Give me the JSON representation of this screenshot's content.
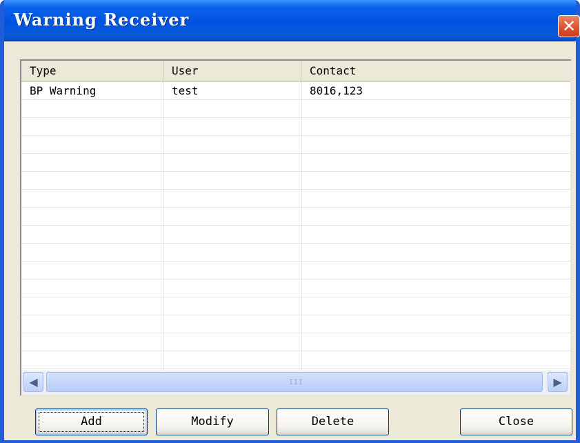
{
  "window": {
    "title": "Warning Receiver",
    "close_glyph": "✕"
  },
  "list": {
    "columns": [
      "Type",
      "User",
      "Contact"
    ],
    "rows": [
      [
        "BP Warning",
        "test",
        "8016,123"
      ]
    ]
  },
  "scrollbar": {
    "left_glyph": "◀",
    "right_glyph": "▶",
    "grip": "III"
  },
  "buttons": {
    "add": "Add",
    "modify": "Modify",
    "delete": "Delete",
    "close": "Close"
  },
  "colors": {
    "titlebar": "#0053e1",
    "face": "#ece9d8",
    "close_button": "#d9502f"
  }
}
